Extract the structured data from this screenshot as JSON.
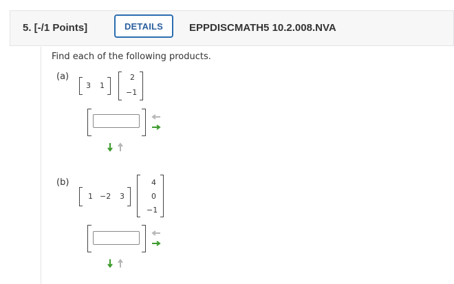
{
  "header": {
    "question_number": "5. [-/1 Points]",
    "details_label": "DETAILS",
    "question_id": "EPPDISCMATH5 10.2.008.NVA"
  },
  "instruction": "Find each of the following products.",
  "parts": [
    {
      "label": "(a)",
      "row_vector": [
        "3",
        "1"
      ],
      "column_vector": [
        "2",
        "−1"
      ],
      "answer_value": ""
    },
    {
      "label": "(b)",
      "row_vector": [
        "1",
        "−2",
        "3"
      ],
      "column_vector": [
        "4",
        "0",
        "−1"
      ],
      "answer_value": ""
    }
  ],
  "colors": {
    "accent": "#2a6db0",
    "arrow_green": "#3a9a2a",
    "arrow_gray": "#b5b5b5"
  },
  "icons": [
    "remove-column-arrow-icon",
    "add-column-arrow-icon",
    "add-row-arrow-icon",
    "remove-row-arrow-icon"
  ]
}
